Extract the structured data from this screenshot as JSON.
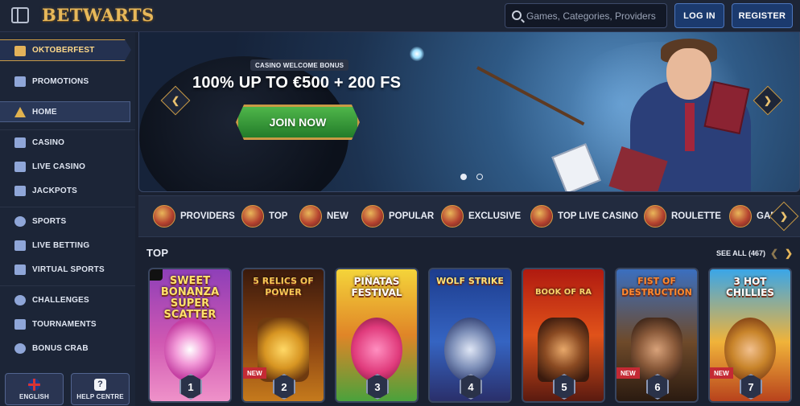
{
  "header": {
    "logo": "BETWARTS",
    "search_placeholder": "Games, Categories, Providers",
    "login_label": "LOG IN",
    "register_label": "REGISTER"
  },
  "sidebar": {
    "items": [
      {
        "label": "OKTOBERFEST",
        "icon": "beer-mug-icon"
      },
      {
        "label": "PROMOTIONS",
        "icon": "promotions-icon"
      },
      {
        "label": "HOME",
        "icon": "wizard-hat-icon"
      },
      {
        "label": "CASINO",
        "icon": "slot-machine-icon"
      },
      {
        "label": "LIVE CASINO",
        "icon": "playing-card-icon"
      },
      {
        "label": "JACKPOTS",
        "icon": "jackpot-icon"
      },
      {
        "label": "SPORTS",
        "icon": "football-icon"
      },
      {
        "label": "LIVE BETTING",
        "icon": "live-betting-icon"
      },
      {
        "label": "VIRTUAL SPORTS",
        "icon": "gamepad-icon"
      },
      {
        "label": "CHALLENGES",
        "icon": "challenge-icon"
      },
      {
        "label": "TOURNAMENTS",
        "icon": "tournament-icon"
      },
      {
        "label": "BONUS CRAB",
        "icon": "crab-icon"
      }
    ],
    "footer": {
      "language_label": "ENGLISH",
      "help_label": "HELP CENTRE",
      "help_glyph": "?"
    }
  },
  "banner": {
    "tag": "CASINO WELCOME BONUS",
    "headline": "100% UP TO €500 + 200 FS",
    "cta": "JOIN NOW",
    "prev_glyph": "❮",
    "next_glyph": "❯",
    "slides": 2,
    "active_slide": 1
  },
  "categories": [
    {
      "label": "PROVIDERS"
    },
    {
      "label": "TOP"
    },
    {
      "label": "NEW"
    },
    {
      "label": "POPULAR"
    },
    {
      "label": "EXCLUSIVE"
    },
    {
      "label": "TOP LIVE CASINO"
    },
    {
      "label": "ROULETTE"
    },
    {
      "label": "GAM"
    }
  ],
  "top_section": {
    "title": "TOP",
    "see_all": "SEE ALL (467)",
    "prev_glyph": "❮",
    "next_glyph": "❯",
    "games": [
      {
        "title": "SWEET BONANZA SUPER SCATTER",
        "rank": "1",
        "badge": ""
      },
      {
        "title": "5 RELICS OF POWER",
        "rank": "2",
        "badge": "NEW"
      },
      {
        "title": "PIÑATAS FESTIVAL",
        "rank": "3",
        "badge": ""
      },
      {
        "title": "WOLF STRIKE",
        "rank": "4",
        "badge": ""
      },
      {
        "title": "BOOK OF RA",
        "rank": "5",
        "badge": ""
      },
      {
        "title": "FIST OF DESTRUCTION",
        "rank": "6",
        "badge": "NEW"
      },
      {
        "title": "3 HOT CHILLIES",
        "rank": "7",
        "badge": "NEW"
      }
    ]
  },
  "colors": {
    "background": "#1a2131",
    "accent_gold": "#c99a45",
    "button_blue": "#1b3a6e",
    "cta_green": "#3a9d3c",
    "new_badge": "#c42a34"
  }
}
